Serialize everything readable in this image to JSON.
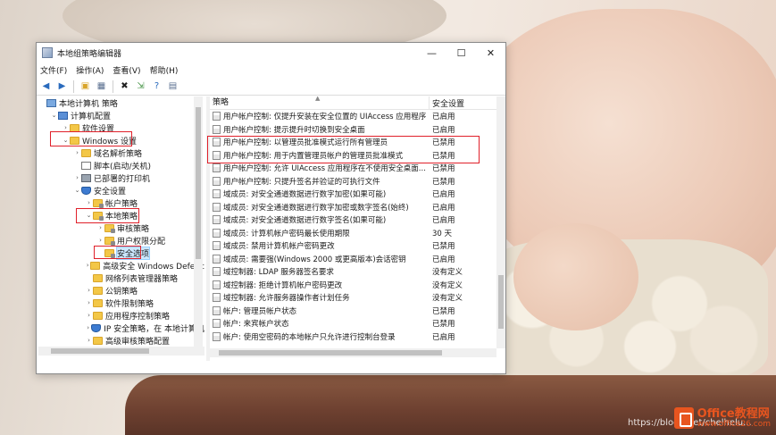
{
  "window": {
    "title": "本地组策略编辑器",
    "controls": {
      "minimize": "—",
      "maximize": "☐",
      "close": "✕"
    }
  },
  "menu": [
    "文件(F)",
    "操作(A)",
    "查看(V)",
    "帮助(H)"
  ],
  "toolbar": [
    "back-icon",
    "forward-icon",
    "up-folder-icon",
    "show-hide-tree-icon",
    "delete-icon",
    "export-icon",
    "help-icon",
    "properties-icon"
  ],
  "tree": [
    {
      "label": "本地计算机 策略",
      "caret": "",
      "icon": "book",
      "indent": 0
    },
    {
      "label": "计算机配置",
      "caret": "⌄",
      "icon": "pc",
      "indent": 1
    },
    {
      "label": "软件设置",
      "caret": "›",
      "icon": "folder",
      "indent": 2
    },
    {
      "label": "Windows 设置",
      "caret": "⌄",
      "icon": "folder",
      "indent": 2
    },
    {
      "label": "域名解析策略",
      "caret": "›",
      "icon": "folder",
      "indent": 3
    },
    {
      "label": "脚本(启动/关机)",
      "caret": "",
      "icon": "doc",
      "indent": 3
    },
    {
      "label": "已部署的打印机",
      "caret": "›",
      "icon": "printer",
      "indent": 3
    },
    {
      "label": "安全设置",
      "caret": "⌄",
      "icon": "shield",
      "indent": 3
    },
    {
      "label": "帐户策略",
      "caret": "›",
      "icon": "folder-lock",
      "indent": 4
    },
    {
      "label": "本地策略",
      "caret": "⌄",
      "icon": "folder-lock",
      "indent": 4
    },
    {
      "label": "审核策略",
      "caret": "›",
      "icon": "folder-lock",
      "indent": 5
    },
    {
      "label": "用户权限分配",
      "caret": "›",
      "icon": "folder-lock",
      "indent": 5
    },
    {
      "label": "安全选项",
      "caret": "",
      "icon": "folder-lock",
      "indent": 5,
      "selected": true
    },
    {
      "label": "高级安全 Windows Defenc",
      "caret": "›",
      "icon": "folder",
      "indent": 4
    },
    {
      "label": "网络列表管理器策略",
      "caret": "",
      "icon": "folder",
      "indent": 4
    },
    {
      "label": "公钥策略",
      "caret": "›",
      "icon": "folder",
      "indent": 4
    },
    {
      "label": "软件限制策略",
      "caret": "›",
      "icon": "folder",
      "indent": 4
    },
    {
      "label": "应用程序控制策略",
      "caret": "›",
      "icon": "folder",
      "indent": 4
    },
    {
      "label": "IP 安全策略，在 本地计算机",
      "caret": "›",
      "icon": "shield",
      "indent": 4
    },
    {
      "label": "高级审核策略配置",
      "caret": "›",
      "icon": "folder",
      "indent": 4
    }
  ],
  "list": {
    "headers": {
      "policy": "策略",
      "setting": "安全设置"
    },
    "rows": [
      {
        "policy": "用户帐户控制: 仅提升安装在安全位置的 UIAccess 应用程序",
        "setting": "已启用"
      },
      {
        "policy": "用户帐户控制: 提示提升时切换到安全桌面",
        "setting": "已启用"
      },
      {
        "policy": "用户帐户控制: 以管理员批准模式运行所有管理员",
        "setting": "已禁用"
      },
      {
        "policy": "用户帐户控制: 用于内置管理员帐户的管理员批准模式",
        "setting": "已禁用"
      },
      {
        "policy": "用户帐户控制: 允许 UIAccess 应用程序在不使用安全桌面...",
        "setting": "已禁用"
      },
      {
        "policy": "用户帐户控制: 只提升签名并验证的可执行文件",
        "setting": "已禁用"
      },
      {
        "policy": "域成员: 对安全通道数据进行数字加密(如果可能)",
        "setting": "已启用"
      },
      {
        "policy": "域成员: 对安全通道数据进行数字加密或数字签名(始终)",
        "setting": "已启用"
      },
      {
        "policy": "域成员: 对安全通道数据进行数字签名(如果可能)",
        "setting": "已启用"
      },
      {
        "policy": "域成员: 计算机帐户密码最长使用期限",
        "setting": "30 天"
      },
      {
        "policy": "域成员: 禁用计算机帐户密码更改",
        "setting": "已禁用"
      },
      {
        "policy": "域成员: 需要强(Windows 2000 或更高版本)会话密钥",
        "setting": "已启用"
      },
      {
        "policy": "域控制器: LDAP 服务器签名要求",
        "setting": "没有定义"
      },
      {
        "policy": "域控制器: 拒绝计算机帐户密码更改",
        "setting": "没有定义"
      },
      {
        "policy": "域控制器: 允许服务器操作者计划任务",
        "setting": "没有定义"
      },
      {
        "policy": "帐户: 管理员帐户状态",
        "setting": "已禁用"
      },
      {
        "policy": "帐户: 来宾帐户状态",
        "setting": "已禁用"
      },
      {
        "policy": "帐户: 使用空密码的本地帐户只允许进行控制台登录",
        "setting": "已启用"
      }
    ]
  },
  "watermark": "https://blog...net/chelhelu...",
  "logo": {
    "text": "Office教程网",
    "sub": "www.office26.com"
  },
  "colors": {
    "highlight": "#e0202a",
    "selection": "#cce8ff",
    "logo": "#e8551f"
  }
}
